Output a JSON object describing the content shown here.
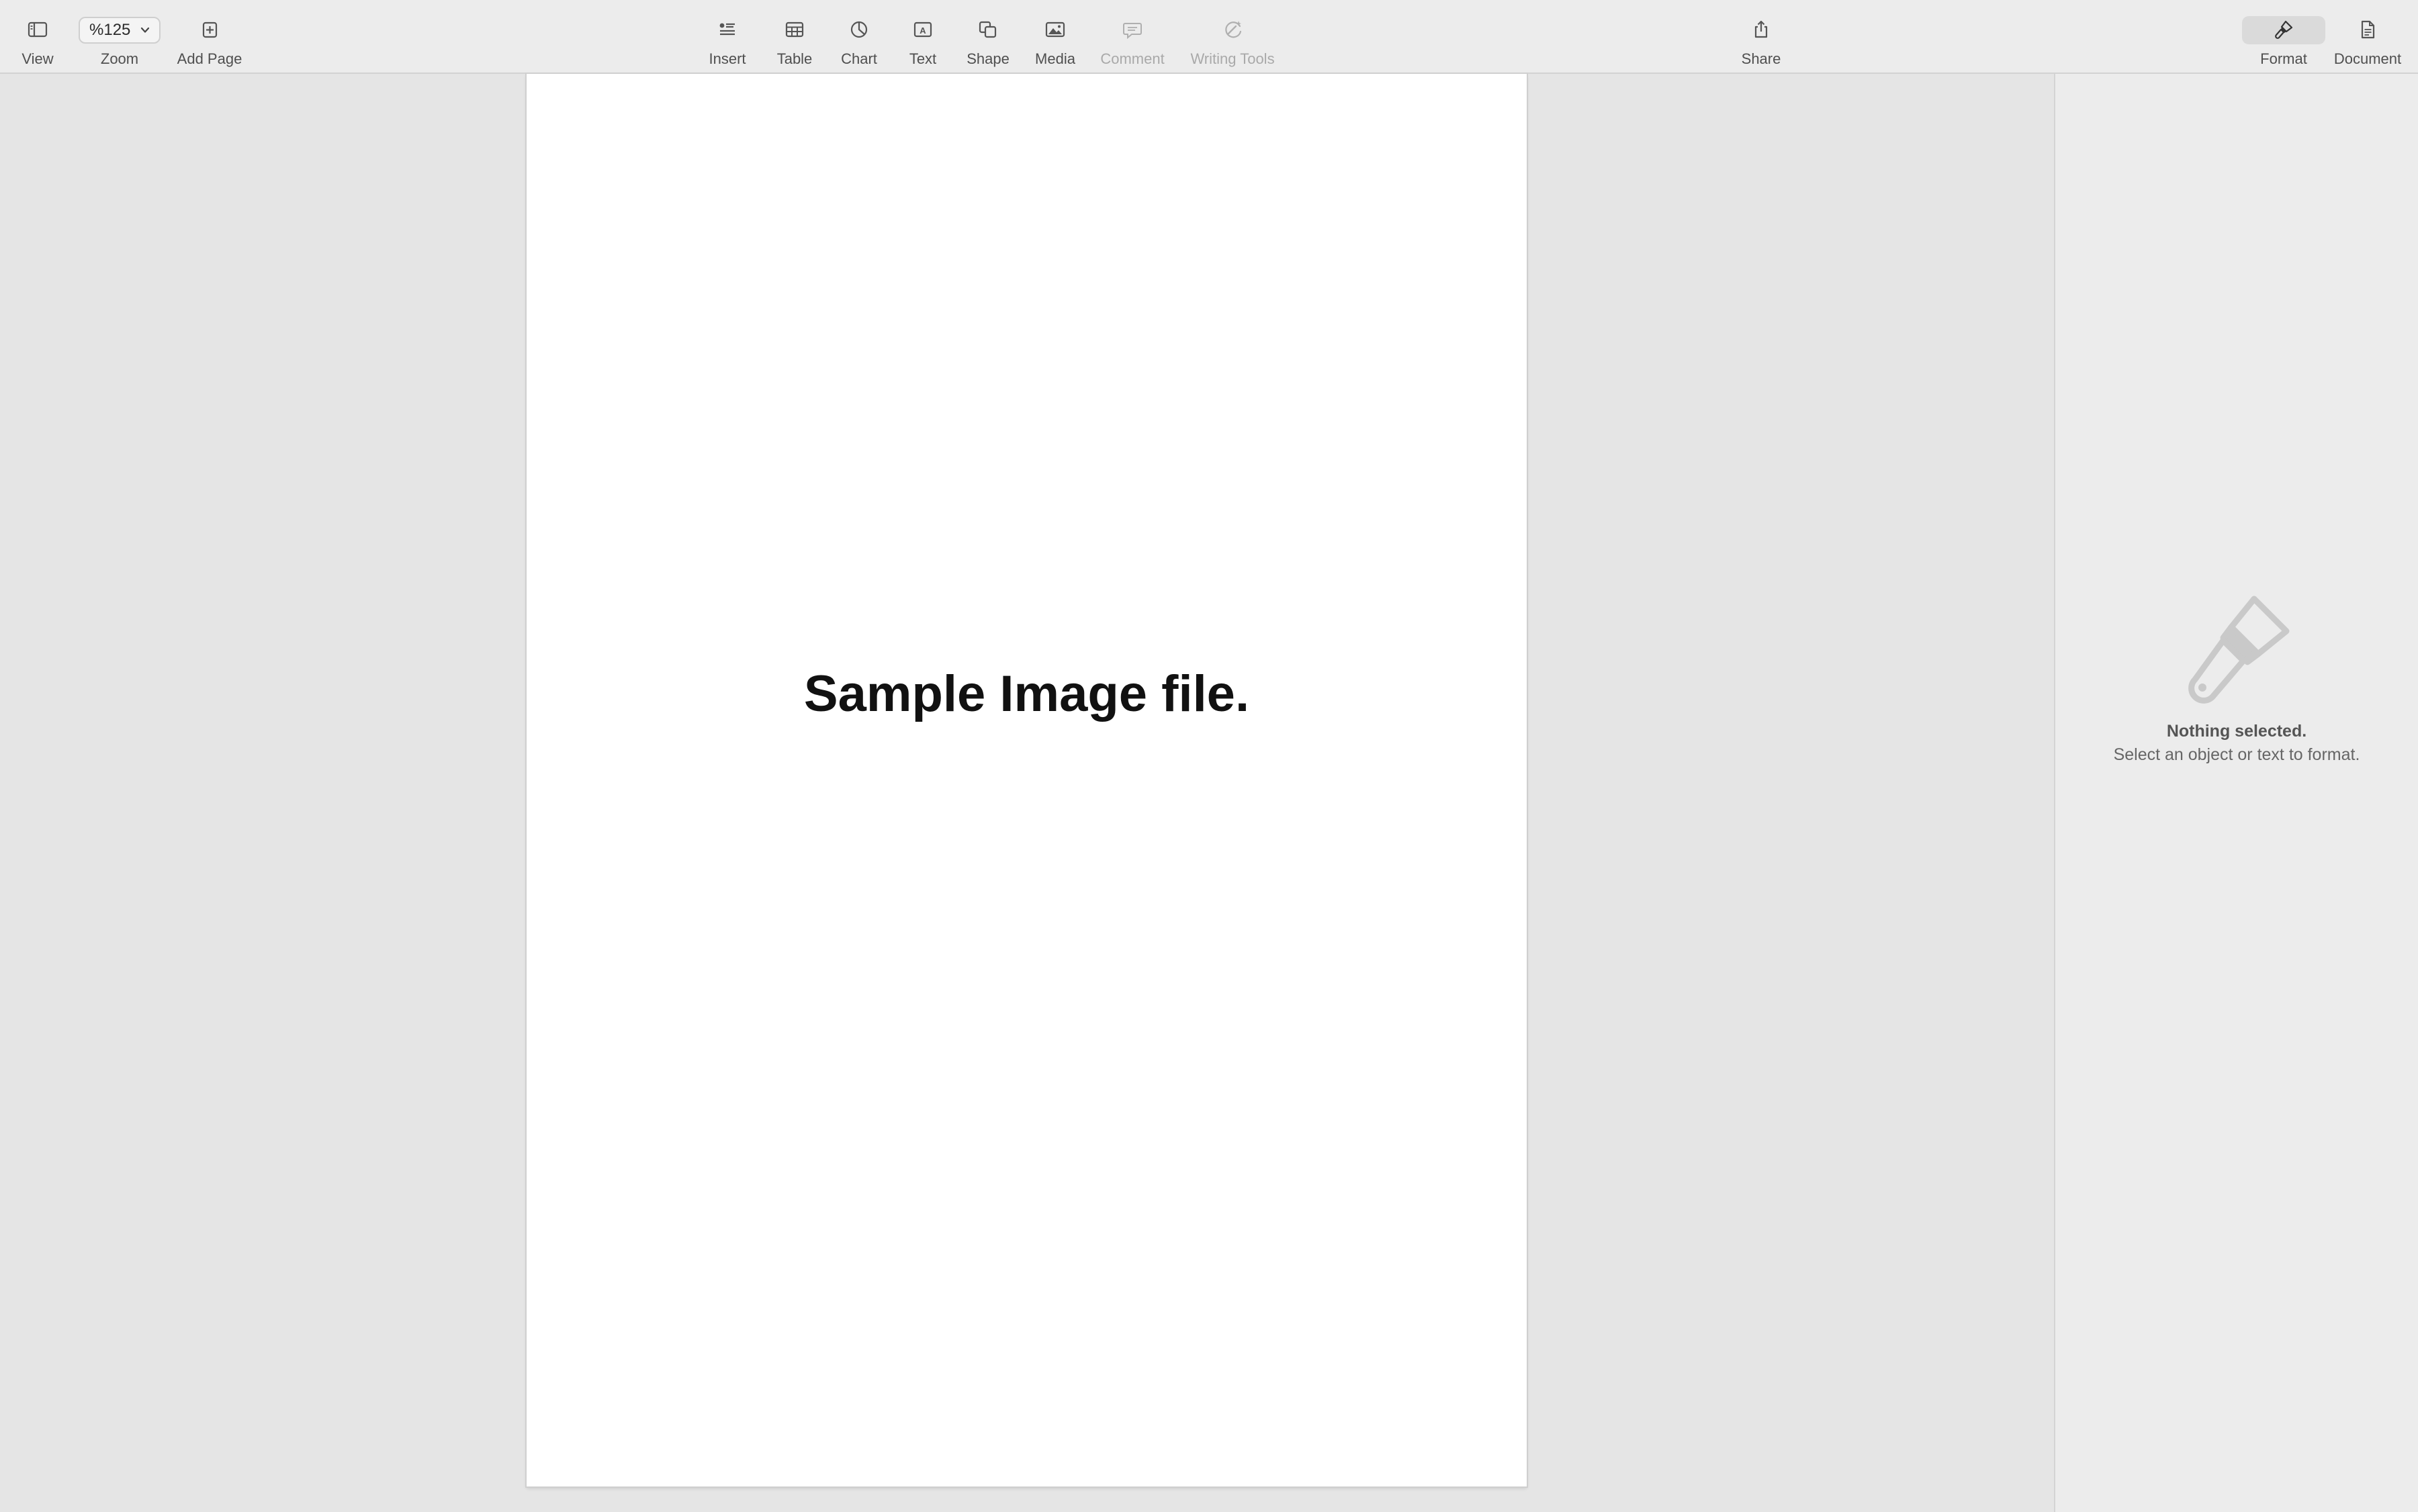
{
  "toolbar": {
    "view": {
      "label": "View",
      "icon": "sidebar-icon"
    },
    "zoom": {
      "label": "Zoom",
      "value": "%125",
      "icon": "chevron-down-icon"
    },
    "add_page": {
      "label": "Add Page",
      "icon": "plus-square-icon"
    },
    "insert": {
      "label": "Insert",
      "icon": "list-insert-icon"
    },
    "table": {
      "label": "Table",
      "icon": "table-icon"
    },
    "chart": {
      "label": "Chart",
      "icon": "pie-chart-icon"
    },
    "text": {
      "label": "Text",
      "icon": "text-box-icon"
    },
    "shape": {
      "label": "Shape",
      "icon": "shape-icon"
    },
    "media": {
      "label": "Media",
      "icon": "photo-icon"
    },
    "comment": {
      "label": "Comment",
      "icon": "comment-icon",
      "enabled": false
    },
    "writing_tools": {
      "label": "Writing Tools",
      "icon": "writing-tools-icon",
      "enabled": false
    },
    "share": {
      "label": "Share",
      "icon": "share-icon"
    },
    "format": {
      "label": "Format",
      "icon": "paintbrush-icon",
      "selected": true
    },
    "document": {
      "label": "Document",
      "icon": "document-icon"
    }
  },
  "document": {
    "title": "Sample Image file."
  },
  "inspector": {
    "empty_title": "Nothing selected.",
    "empty_subtitle": "Select an object or text to format."
  },
  "colors": {
    "toolbar_bg": "#ececec",
    "canvas_bg": "#e5e5e5",
    "page_bg": "#ffffff",
    "inspector_bg": "#ececec"
  }
}
